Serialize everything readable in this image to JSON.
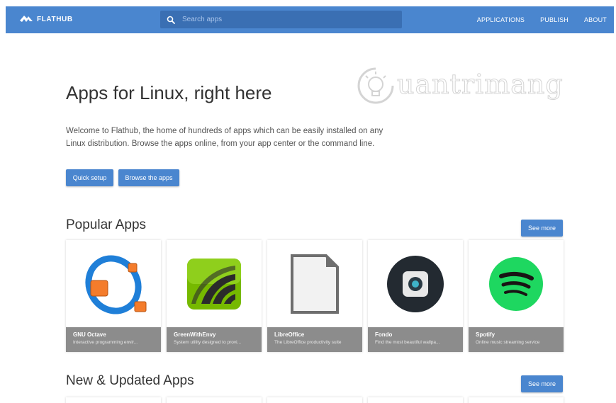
{
  "header": {
    "logo_text": "FLATHUB",
    "search_placeholder": "Search apps",
    "nav": [
      "APPLICATIONS",
      "PUBLISH",
      "ABOUT"
    ]
  },
  "hero": {
    "title": "Apps for Linux, right here",
    "description": "Welcome to Flathub, the home of hundreds of apps which can be easily installed on any Linux distribution. Browse the apps online, from your app center or the command line.",
    "quick_setup_label": "Quick setup",
    "browse_label": "Browse the apps"
  },
  "watermark": "uantrimang",
  "popular": {
    "title": "Popular Apps",
    "see_more": "See more",
    "apps": [
      {
        "name": "GNU Octave",
        "summary": "Interactive programming envir...",
        "icon": "octave-icon"
      },
      {
        "name": "GreenWithEnvy",
        "summary": "System utility designed to provi...",
        "icon": "greenwithenvy-icon"
      },
      {
        "name": "LibreOffice",
        "summary": "The LibreOffice productivity suite",
        "icon": "libreoffice-icon"
      },
      {
        "name": "Fondo",
        "summary": "Find the most beautiful wallpa...",
        "icon": "fondo-icon"
      },
      {
        "name": "Spotify",
        "summary": "Online music streaming service",
        "icon": "spotify-icon"
      }
    ]
  },
  "new_updated": {
    "title": "New & Updated Apps",
    "see_more": "See more"
  },
  "colors": {
    "brand": "#4a86cf",
    "header": "#4a86cf",
    "search_bg": "#3a6fb3",
    "card_footer": "#8c8c8c"
  }
}
